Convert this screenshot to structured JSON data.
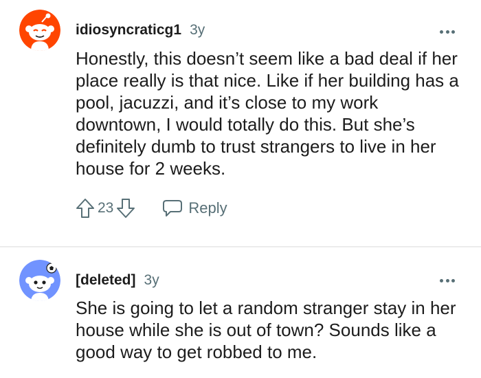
{
  "comments": [
    {
      "username": "idiosyncraticg1",
      "age": "3y",
      "body": "Honestly, this doesn’t seem like a bad deal if her place really is that nice. Like if her building has a pool, jacuzzi, and it’s close to my work downtown, I would totally do this. But she’s definitely dumb to trust strangers to live in her house for 2 weeks.",
      "score": "23",
      "reply_label": "Reply",
      "avatar_color": "#ff4500"
    },
    {
      "username": "[deleted]",
      "age": "3y",
      "body": "She is going to let a random stranger stay in her house while she is out of town? Sounds like a good way to get robbed to me.",
      "avatar_color": "#7193ff"
    }
  ],
  "icons": {
    "upvote": "upvote-arrow-icon",
    "downvote": "downvote-arrow-icon",
    "reply": "speech-bubble-icon",
    "more": "more-options-icon"
  },
  "colors": {
    "text": "#1c1c1c",
    "muted": "#576f76",
    "divider": "#ececec"
  }
}
